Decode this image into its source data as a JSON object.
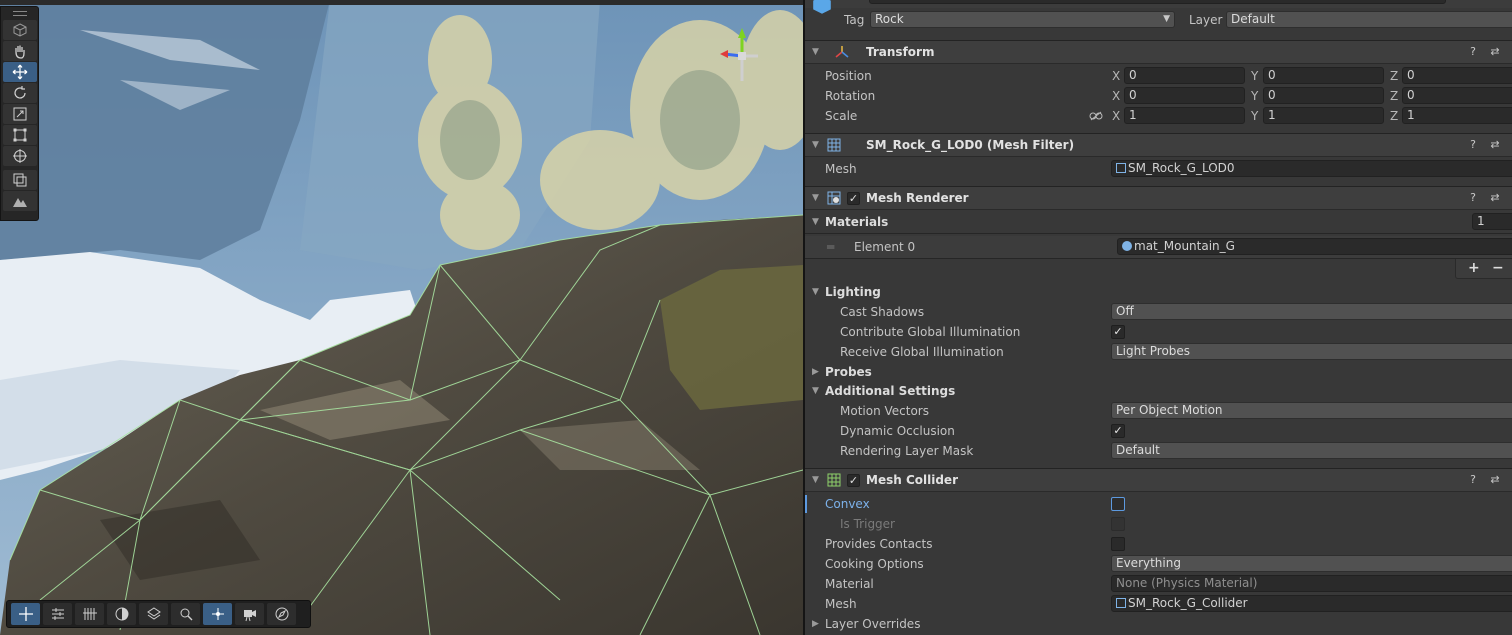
{
  "scene": {
    "tools": [
      {
        "icon": "view-cube-icon",
        "active": false
      },
      {
        "icon": "hand-icon",
        "active": false
      },
      {
        "icon": "move-icon",
        "active": true
      },
      {
        "icon": "rotate-icon",
        "active": false
      },
      {
        "icon": "scale-icon",
        "active": false
      },
      {
        "icon": "rect-transform-icon",
        "active": false
      },
      {
        "icon": "transform-icon",
        "active": false
      },
      {
        "icon": "custom-tool-icon",
        "active": false
      },
      {
        "icon": "terrain-tool-icon",
        "active": false
      }
    ],
    "overlay_buttons": [
      {
        "icon": "move-tool-icon",
        "on": true
      },
      {
        "icon": "align-icon",
        "on": false
      },
      {
        "icon": "grid-snap-icon",
        "on": false
      },
      {
        "icon": "shading-icon",
        "on": false
      },
      {
        "icon": "layers-icon",
        "on": false
      },
      {
        "icon": "search-icon",
        "on": false
      },
      {
        "icon": "pivot-icon",
        "on": true
      },
      {
        "icon": "camera-icon",
        "on": false
      },
      {
        "icon": "compass-icon",
        "on": false
      }
    ]
  },
  "inspector": {
    "tag_label": "Tag",
    "tag_value": "Rock",
    "layer_label": "Layer",
    "layer_value": "Default",
    "transform": {
      "title": "Transform",
      "position_label": "Position",
      "rotation_label": "Rotation",
      "scale_label": "Scale",
      "axis_x": "X",
      "axis_y": "Y",
      "axis_z": "Z",
      "position": [
        "0",
        "0",
        "0"
      ],
      "rotation": [
        "0",
        "0",
        "0"
      ],
      "scale": [
        "1",
        "1",
        "1"
      ]
    },
    "mesh_filter": {
      "title": "SM_Rock_G_LOD0 (Mesh Filter)",
      "mesh_label": "Mesh",
      "mesh_value": "SM_Rock_G_LOD0"
    },
    "mesh_renderer": {
      "title": "Mesh Renderer",
      "materials_label": "Materials",
      "materials_count": "1",
      "element_label": "Element 0",
      "element_value": "mat_Mountain_G",
      "add_label": "+",
      "remove_label": "−",
      "lighting_label": "Lighting",
      "cast_shadows_label": "Cast Shadows",
      "cast_shadows_value": "Off",
      "contribute_gi_label": "Contribute Global Illumination",
      "receive_gi_label": "Receive Global Illumination",
      "receive_gi_value": "Light Probes",
      "probes_label": "Probes",
      "additional_label": "Additional Settings",
      "motion_vectors_label": "Motion Vectors",
      "motion_vectors_value": "Per Object Motion",
      "dynamic_occlusion_label": "Dynamic Occlusion",
      "rendering_layer_label": "Rendering Layer Mask",
      "rendering_layer_value": "Default"
    },
    "mesh_collider": {
      "title": "Mesh Collider",
      "convex_label": "Convex",
      "is_trigger_label": "Is Trigger",
      "provides_contacts_label": "Provides Contacts",
      "cooking_options_label": "Cooking Options",
      "cooking_options_value": "Everything",
      "material_label": "Material",
      "material_value": "None (Physics Material)",
      "mesh_label": "Mesh",
      "mesh_value": "SM_Rock_G_Collider",
      "layer_overrides_label": "Layer Overrides"
    },
    "check_mark": "✓",
    "help_icon": "?",
    "presets_icon": "⇄",
    "menu_icon": "⋮"
  }
}
